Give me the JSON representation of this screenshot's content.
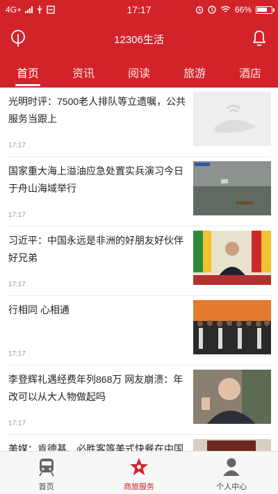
{
  "status_bar": {
    "network": "4G+",
    "time": "17:17",
    "battery": "66%"
  },
  "header": {
    "title": "12306生活"
  },
  "tabs": [
    {
      "label": "首页",
      "active": true
    },
    {
      "label": "资讯",
      "active": false
    },
    {
      "label": "阅读",
      "active": false
    },
    {
      "label": "旅游",
      "active": false
    },
    {
      "label": "酒店",
      "active": false
    }
  ],
  "feed": [
    {
      "title": "光明时评：7500老人排队等立遗嘱，公共服务当跟上",
      "time": "17:17",
      "thumb": "placeholder-image"
    },
    {
      "title": "国家重大海上溢油应急处置实兵演习今日于舟山海域举行",
      "time": "17:17",
      "thumb": "sea-ship-photo"
    },
    {
      "title": "习近平：中国永远是非洲的好朋友好伙伴好兄弟",
      "time": "17:17",
      "thumb": "leader-flags-photo"
    },
    {
      "title": "行相同 心相通",
      "time": "17:17",
      "thumb": "group-photo"
    },
    {
      "title": "李登辉礼遇经费年列868万 网友崩溃：年改可以从大人物做起吗",
      "time": "17:17",
      "thumb": "speaker-photo"
    },
    {
      "title": "美媒：肯德基、必胜客等美式快餐在中国",
      "time": "",
      "thumb": "restaurant-photo"
    }
  ],
  "bottom_nav": [
    {
      "label": "首页",
      "icon": "train-icon",
      "active": false
    },
    {
      "label": "商旅服务",
      "icon": "star-badge-icon",
      "active": true
    },
    {
      "label": "个人中心",
      "icon": "person-icon",
      "active": false
    }
  ],
  "colors": {
    "brand_red": "#d2232a",
    "text": "#222222",
    "muted": "#999999"
  }
}
